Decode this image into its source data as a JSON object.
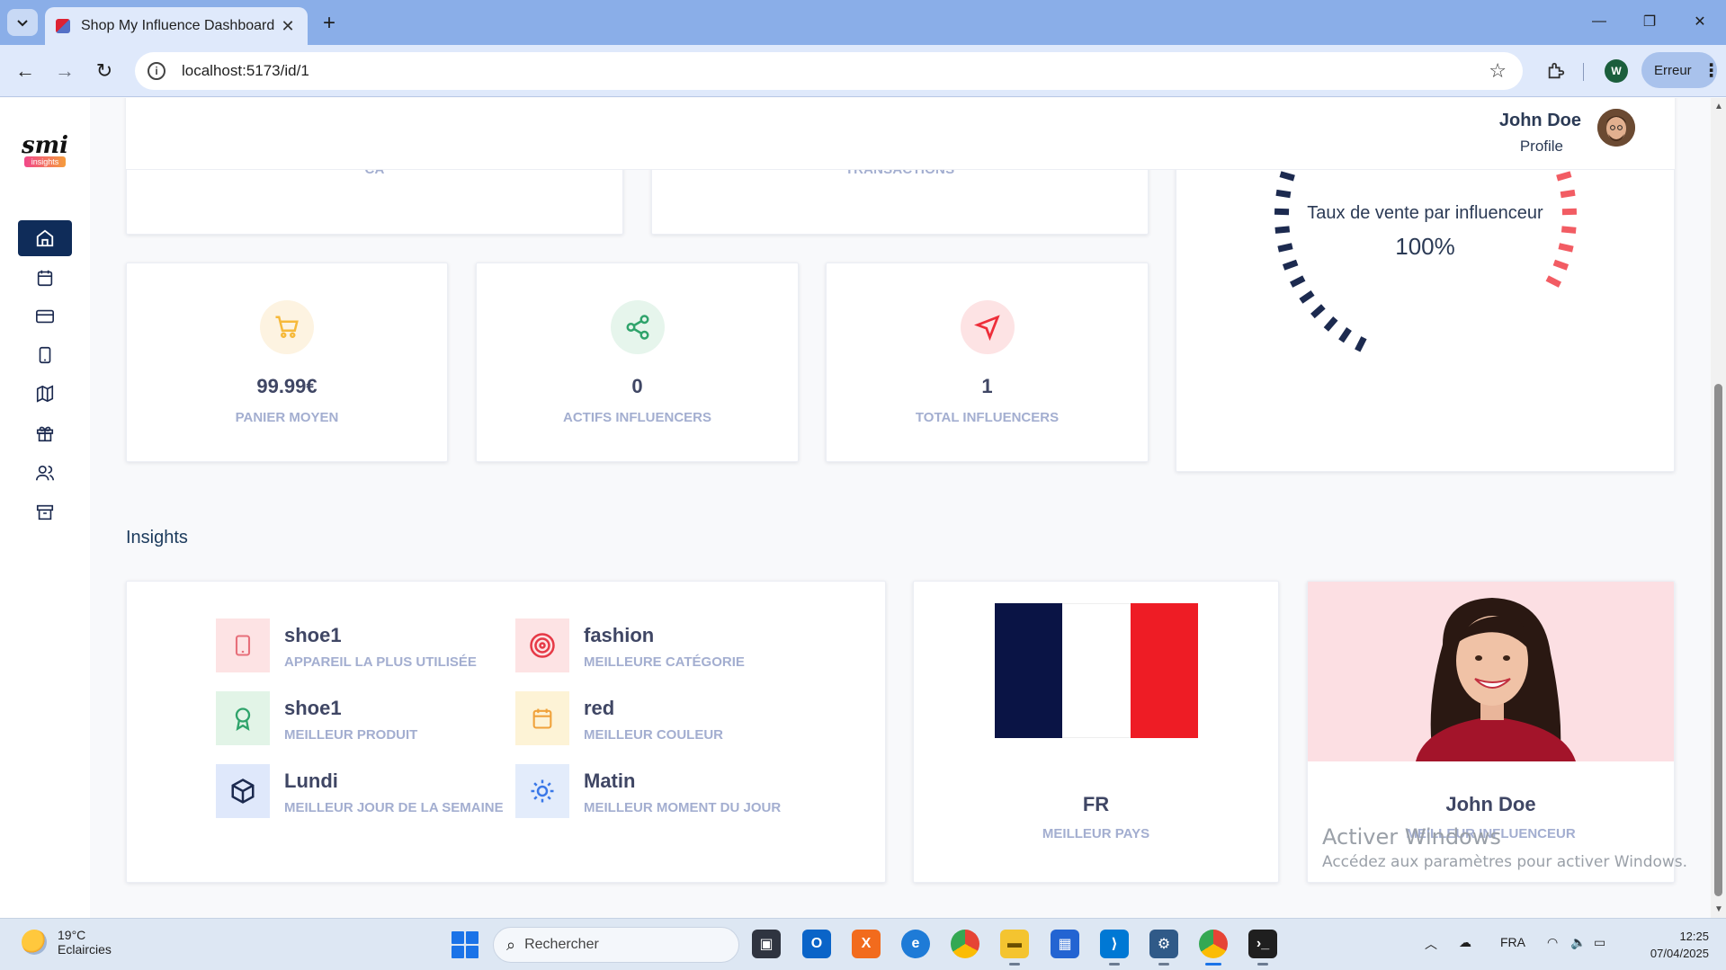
{
  "browser": {
    "tab_title": "Shop My Influence Dashboard",
    "url": "localhost:5173/id/1",
    "profile_initial": "W",
    "profile_status": "Erreur"
  },
  "app": {
    "logo_text": "smi",
    "logo_sub": "insights",
    "nav_items": [
      {
        "icon": "home-icon",
        "active": true
      },
      {
        "icon": "calendar-icon",
        "active": false
      },
      {
        "icon": "credit-card-icon",
        "active": false
      },
      {
        "icon": "tablet-icon",
        "active": false
      },
      {
        "icon": "map-icon",
        "active": false
      },
      {
        "icon": "gift-icon",
        "active": false
      },
      {
        "icon": "users-icon",
        "active": false
      },
      {
        "icon": "archive-icon",
        "active": false
      }
    ],
    "user": {
      "name": "John Doe",
      "subtitle": "Profile"
    }
  },
  "top_cards": {
    "ca_label": "CA",
    "transactions_label": "TRANSACTIONS"
  },
  "stats": [
    {
      "value": "99.99€",
      "label": "PANIER MOYEN",
      "icon": "cart-icon",
      "color": "#f6b93b",
      "bg": "#fdf3e1"
    },
    {
      "value": "0",
      "label": "ACTIFS INFLUENCERS",
      "icon": "share-icon",
      "color": "#2fa36b",
      "bg": "#e6f5ec"
    },
    {
      "value": "1",
      "label": "TOTAL INFLUENCERS",
      "icon": "cursor-icon",
      "color": "#ee2e3a",
      "bg": "#fde3e4"
    }
  ],
  "gauge": {
    "title": "Taux de vente par influenceur",
    "value": "100%",
    "value_fraction": 1.0,
    "colors": {
      "dark": "#1c2a4f",
      "red": "#f25c63"
    }
  },
  "insights_title": "Insights",
  "insights": [
    {
      "value": "shoe1",
      "label": "APPAREIL LA PLUS UTILISÉE",
      "icon": "tablet-icon",
      "color": "#e76f7a",
      "bg": "#fde3e4"
    },
    {
      "value": "fashion",
      "label": "MEILLEURE CATÉGORIE",
      "icon": "target-icon",
      "color": "#e63946",
      "bg": "#fde3e4"
    },
    {
      "value": "shoe1",
      "label": "MEILLEUR PRODUIT",
      "icon": "award-icon",
      "color": "#2fa36b",
      "bg": "#e2f4e7"
    },
    {
      "value": "red",
      "label": "MEILLEUR COULEUR",
      "icon": "calendar-icon",
      "color": "#f0a23b",
      "bg": "#fdf3d6"
    },
    {
      "value": "Lundi",
      "label": "MEILLEUR JOUR DE LA SEMAINE",
      "icon": "box-icon",
      "color": "#1c2a4f",
      "bg": "#dfe8fb"
    },
    {
      "value": "Matin",
      "label": "MEILLEUR MOMENT DU JOUR",
      "icon": "sun-icon",
      "color": "#3a78e8",
      "bg": "#e3ecfb"
    }
  ],
  "country": {
    "value": "FR",
    "label": "MEILLEUR PAYS",
    "flag_colors": [
      "#0a1445",
      "#ffffff",
      "#ee1c25"
    ]
  },
  "influencer": {
    "name": "John Doe",
    "label": "MEILLEUR INFLUENCEUR"
  },
  "watermark": {
    "line1": "Activer Windows",
    "line2": "Accédez aux paramètres pour activer Windows."
  },
  "taskbar": {
    "weather_temp": "19°C",
    "weather_desc": "Eclaircies",
    "search_placeholder": "Rechercher",
    "lang": "FRA",
    "time": "12:25",
    "date": "07/04/2025"
  }
}
